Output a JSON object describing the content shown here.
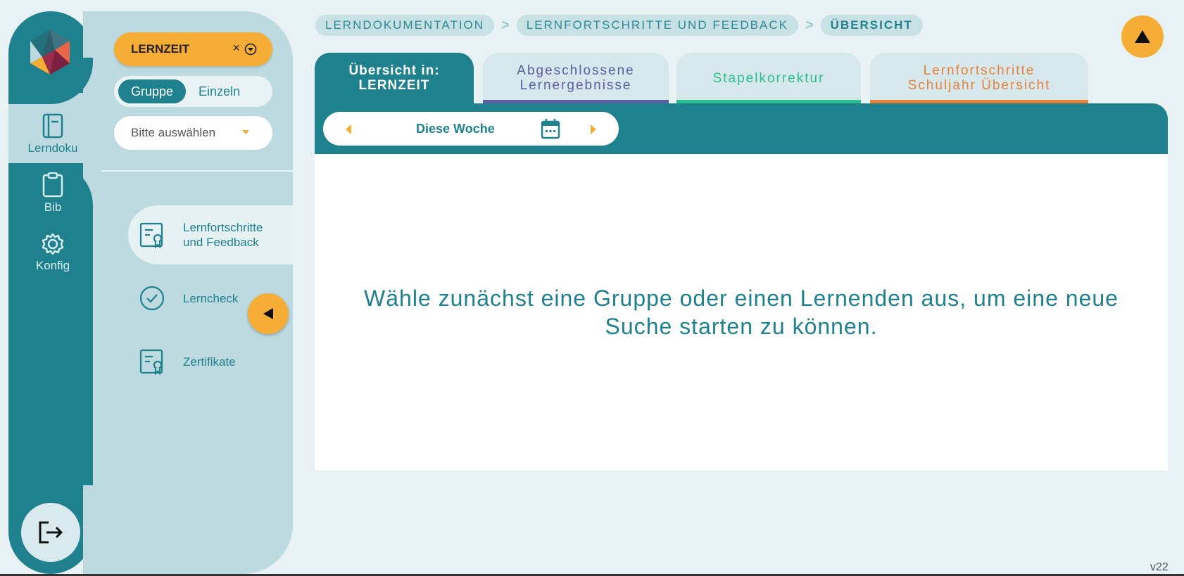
{
  "rail": {
    "items": [
      {
        "label": "Lerndoku",
        "icon": "notebook-icon"
      },
      {
        "label": "Bib",
        "icon": "clipboard-icon"
      },
      {
        "label": "Konfig",
        "icon": "gear-icon"
      }
    ],
    "logout_icon": "logout-icon"
  },
  "panel": {
    "chip": {
      "label": "LERNZEIT",
      "clear": "×"
    },
    "toggle": {
      "group": "Gruppe",
      "single": "Einzeln"
    },
    "select": {
      "placeholder": "Bitte auswählen"
    },
    "nav": [
      {
        "label_line1": "Lernfortschritte",
        "label_line2": "und Feedback",
        "icon": "certificate-icon"
      },
      {
        "label_line1": "Lerncheck",
        "label_line2": "",
        "icon": "check-circle-icon"
      },
      {
        "label_line1": "Zertifikate",
        "label_line2": "",
        "icon": "certificate-icon"
      }
    ]
  },
  "breadcrumb": {
    "items": [
      "LERNDOKUMENTATION",
      "LERNFORTSCHRITTE UND FEEDBACK",
      "ÜBERSICHT"
    ],
    "separator": ">"
  },
  "tabs": [
    {
      "line1": "Übersicht in:",
      "line2": "LERNZEIT",
      "color": "#ffffff"
    },
    {
      "line1": "Abgeschlossene",
      "line2": "Lernergebnisse",
      "color": "#5a5ea3"
    },
    {
      "line1": "Stapelkorrektur",
      "line2": "",
      "color": "#2bbf8c"
    },
    {
      "line1": "Lernfortschritte",
      "line2": "Schuljahr Übersicht",
      "color": "#e8813a"
    }
  ],
  "week": {
    "label": "Diese Woche"
  },
  "message": "Wähle zunächst eine Gruppe oder einen Lernenden aus, um eine neue Suche starten zu können.",
  "version": "v22",
  "colors": {
    "primary": "#1f818e",
    "accent": "#f6ad35",
    "panel": "#bcdadf"
  }
}
